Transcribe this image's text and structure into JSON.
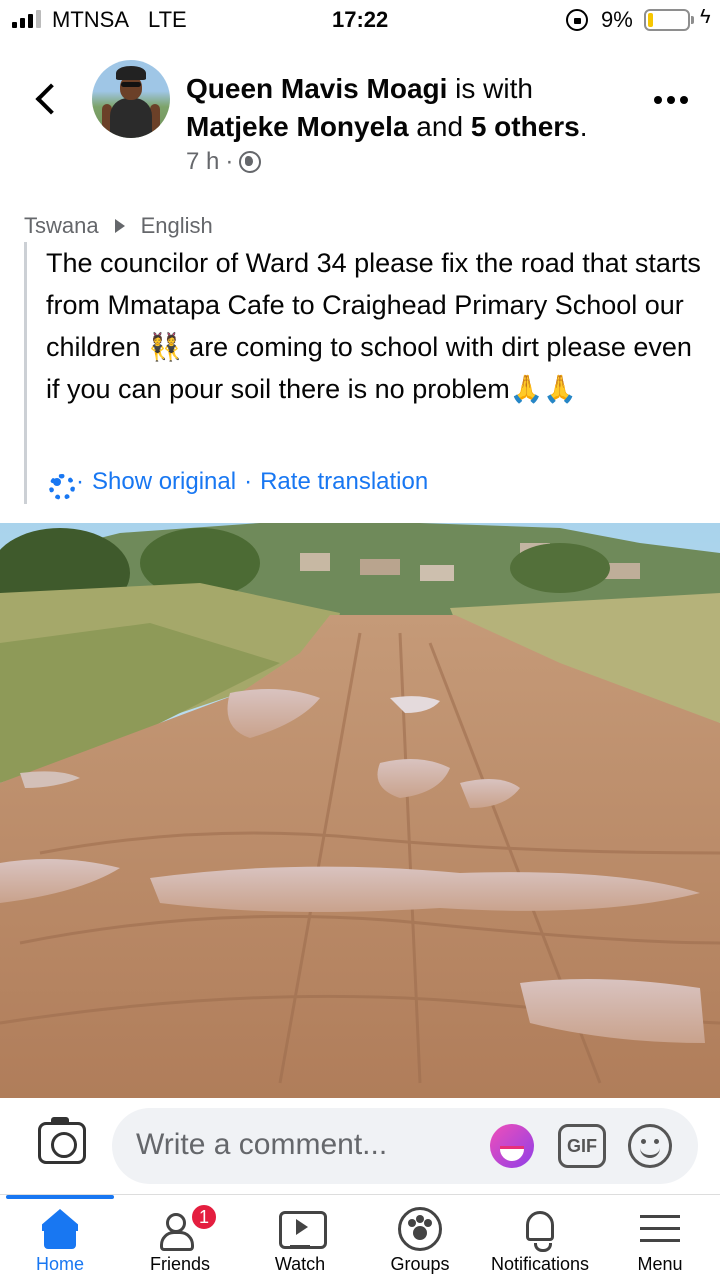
{
  "status_bar": {
    "carrier": "MTNSA",
    "network": "LTE",
    "time": "17:22",
    "battery_percent": "9%",
    "battery_level": 0.09
  },
  "post": {
    "author": "Queen Mavis Moagi",
    "with_text": " is with",
    "tagged": "Matjeke Monyela",
    "and_text": " and ",
    "others": "5 others",
    "period": ".",
    "time_ago": "7 h",
    "dot": "·",
    "source_language": "Tswana",
    "target_language": "English",
    "text": "The councilor of Ward 34 please fix the road that starts from Mmatapa Cafe to Craighead Primary School our children 👯 are coming to school with dirt please even if you can pour soil there is no problem🙏🙏",
    "show_original": "Show original",
    "rate_translation": "Rate translation",
    "separator": "·"
  },
  "comment_bar": {
    "placeholder": "Write a comment...",
    "gif_label": "GIF"
  },
  "bottom_nav": {
    "items": [
      {
        "label": "Home",
        "icon": "home-icon",
        "active": true
      },
      {
        "label": "Friends",
        "icon": "friends-icon",
        "badge": "1"
      },
      {
        "label": "Watch",
        "icon": "watch-icon"
      },
      {
        "label": "Groups",
        "icon": "groups-icon"
      },
      {
        "label": "Notifications",
        "icon": "bell-icon"
      },
      {
        "label": "Menu",
        "icon": "menu-icon"
      }
    ]
  },
  "colors": {
    "accent": "#1877f2",
    "badge": "#e41e3f",
    "battery": "#f7c600"
  }
}
